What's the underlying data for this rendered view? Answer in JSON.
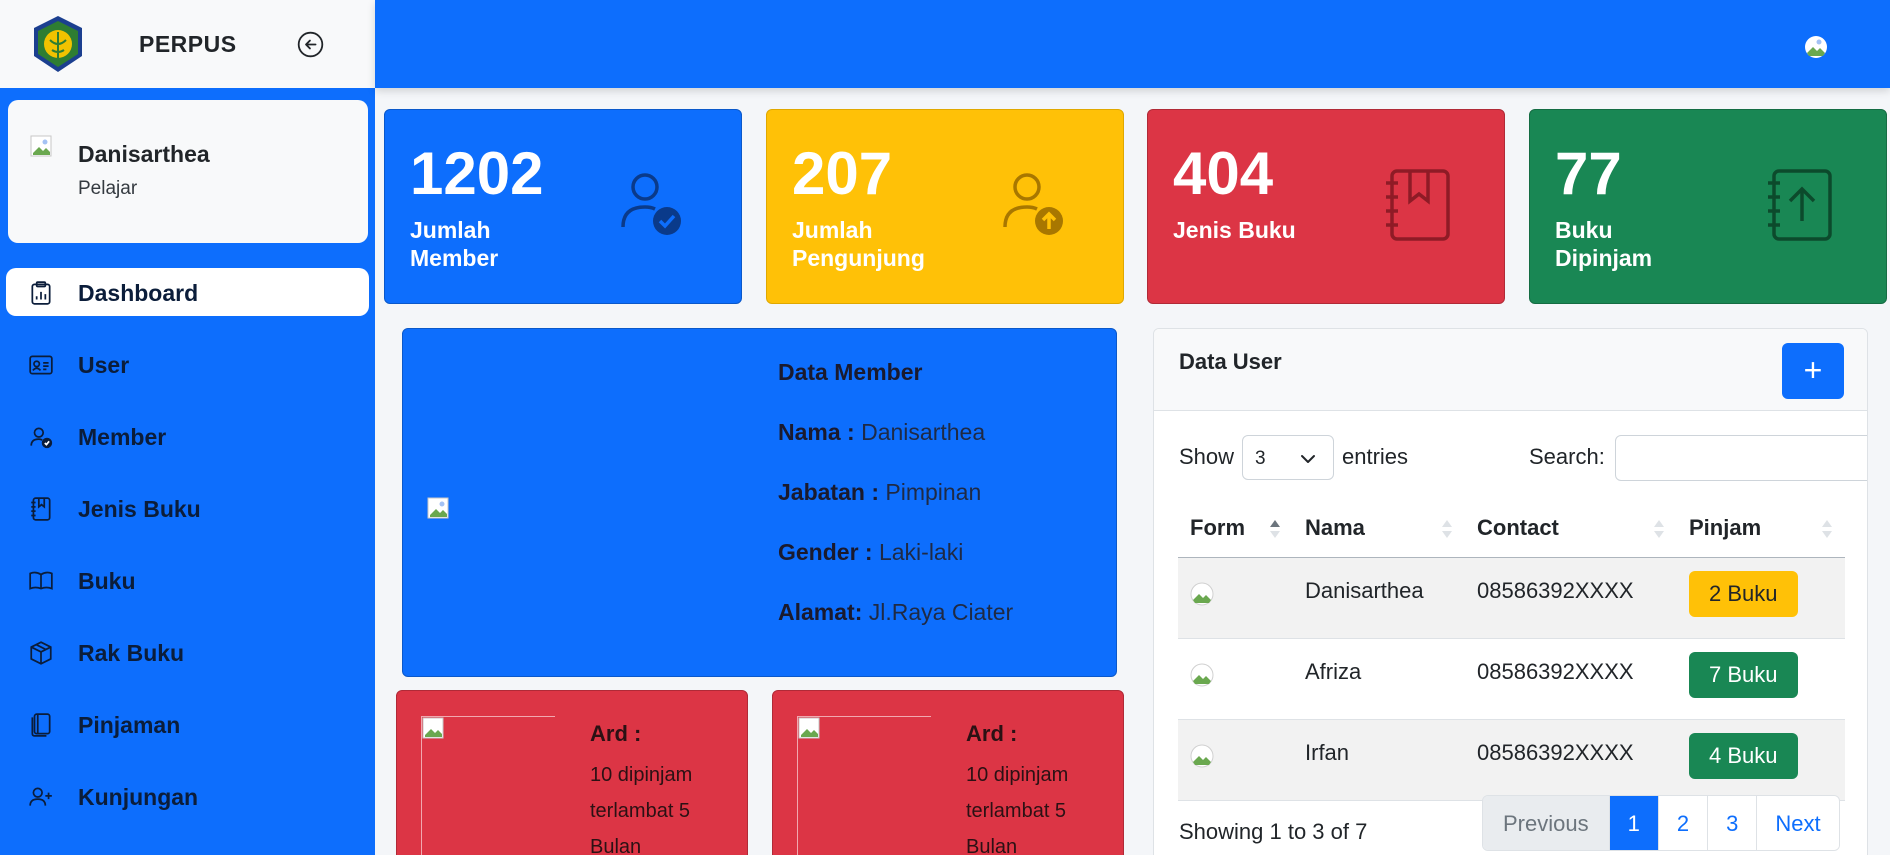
{
  "brand": {
    "name": "PERPUS",
    "logo_icon": "university-emblem-icon",
    "toggle_icon": "arrow-left-circle-icon"
  },
  "profile": {
    "name": "Danisarthea",
    "role": "Pelajar"
  },
  "sidebar": {
    "items": [
      {
        "label": "Dashboard",
        "icon": "clipboard-data-icon",
        "active": true
      },
      {
        "label": "User",
        "icon": "person-vcard-icon"
      },
      {
        "label": "Member",
        "icon": "person-check-icon"
      },
      {
        "label": "Jenis Buku",
        "icon": "journal-bookmark-icon"
      },
      {
        "label": "Buku",
        "icon": "book-icon"
      },
      {
        "label": "Rak Buku",
        "icon": "box-icon"
      },
      {
        "label": "Pinjaman",
        "icon": "journals-icon"
      },
      {
        "label": "Kunjungan",
        "icon": "person-plus-icon"
      }
    ]
  },
  "stats": [
    {
      "value": "1202",
      "label": "Jumlah Member",
      "icon": "person-check-icon",
      "color": "#0d6efd"
    },
    {
      "value": "207",
      "label": "Jumlah Pengunjung",
      "icon": "person-up-icon",
      "color": "#ffc107"
    },
    {
      "value": "404",
      "label": "Jenis Buku",
      "icon": "journal-bookmark-icon",
      "color": "#dc3545"
    },
    {
      "value": "77",
      "label": "Buku Dipinjam",
      "icon": "journal-arrow-up-icon",
      "color": "#198754"
    }
  ],
  "member": {
    "title": "Data Member",
    "nama_label": "Nama :",
    "nama": "Danisarthea",
    "jabatan_label": "Jabatan :",
    "jabatan": "Pimpinan",
    "gender_label": "Gender :",
    "gender": "Laki-laki",
    "alamat_label": "Alamat:",
    "alamat": "Jl.Raya Ciater"
  },
  "loans": [
    {
      "name": "Ard :",
      "desc": "10 dipinjam terlambat 5 Bulan"
    },
    {
      "name": "Ard :",
      "desc": "10 dipinjam terlambat 5 Bulan"
    }
  ],
  "users": {
    "title": "Data User",
    "add_label": "+",
    "show_label": "Show",
    "show_value": "3",
    "entries_label": "entries",
    "search_label": "Search:",
    "search_value": "",
    "columns": [
      "Form",
      "Nama",
      "Contact",
      "Pinjam"
    ],
    "rows": [
      {
        "nama": "Danisarthea",
        "contact": "08586392XXXX",
        "pinjam": "2 Buku",
        "status": "warning"
      },
      {
        "nama": "Afriza",
        "contact": "08586392XXXX",
        "pinjam": "7 Buku",
        "status": "success"
      },
      {
        "nama": "Irfan",
        "contact": "08586392XXXX",
        "pinjam": "4 Buku",
        "status": "success"
      }
    ],
    "info": "Showing 1 to 3 of 7",
    "pagination": {
      "previous": "Previous",
      "pages": [
        "1",
        "2",
        "3"
      ],
      "current": "1",
      "next": "Next"
    }
  },
  "colors": {
    "primary": "#0d6efd",
    "warning": "#ffc107",
    "danger": "#dc3545",
    "success": "#198754"
  }
}
